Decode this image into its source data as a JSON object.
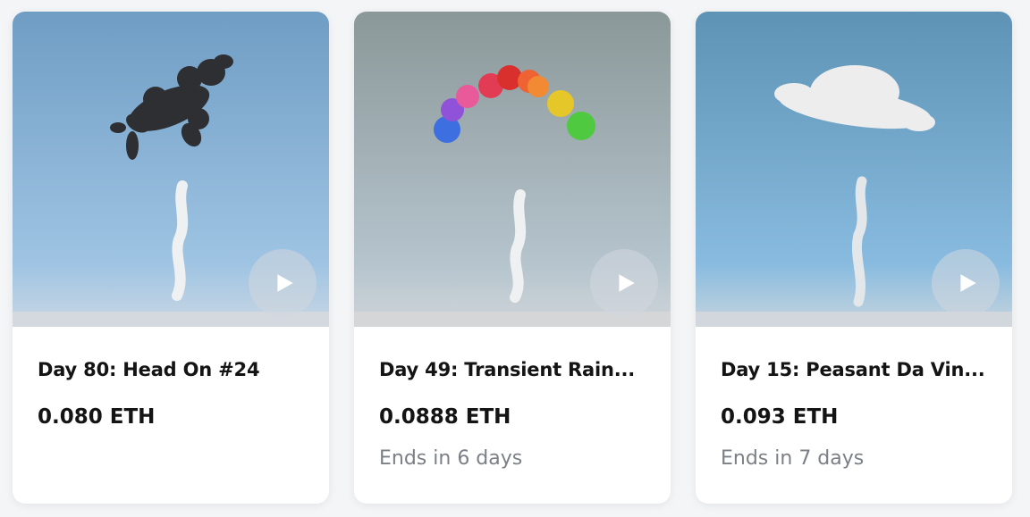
{
  "cards": [
    {
      "title": "Day 80: Head On #24",
      "price": "0.080 ETH",
      "ends": "",
      "subject_icon": "dog-cloud-icon",
      "sky_top": "#6f9dc4",
      "sky_bottom": "#a8c9e6"
    },
    {
      "title": "Day 49: Transient Rain...",
      "price": "0.0888 ETH",
      "ends": "Ends in 6 days",
      "subject_icon": "rainbow-cloud-icon",
      "sky_top": "#8d9a9c",
      "sky_bottom": "#c3cfd8"
    },
    {
      "title": "Day 15: Peasant Da Vin...",
      "price": "0.093 ETH",
      "ends": "Ends in 7 days",
      "subject_icon": "ufo-cloud-icon",
      "sky_top": "#5e93b5",
      "sky_bottom": "#8fbfe2"
    }
  ],
  "play_icon": "play-icon"
}
